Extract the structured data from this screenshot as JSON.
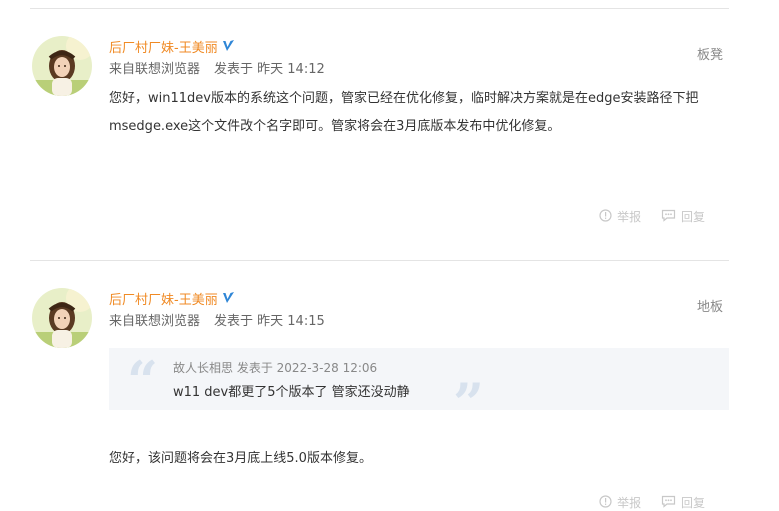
{
  "posts": [
    {
      "author": "后厂村厂妹-王美丽",
      "source": "来自联想浏览器",
      "posted": "发表于 昨天 14:12",
      "floor": "板凳",
      "content_lines": [
        "您好，win11dev版本的系统这个问题，管家已经在优化修复，临时解决方案就是在edge安装路径下把",
        "msedge.exe这个文件改个名字即可。管家将会在3月底版本发布中优化修复。"
      ],
      "report_label": "举报",
      "reply_label": "回复"
    },
    {
      "author": "后厂村厂妹-王美丽",
      "source": "来自联想浏览器",
      "posted": "发表于 昨天 14:15",
      "floor": "地板",
      "quote": {
        "author": "故人长相思",
        "posted": "发表于 2022-3-28 12:06",
        "text": "w11 dev都更了5个版本了 管家还没动静"
      },
      "content_lines": [
        "您好，该问题将会在3月底上线5.0版本修复。"
      ],
      "report_label": "举报",
      "reply_label": "回复"
    }
  ],
  "colors": {
    "author": "#f08a24",
    "badge": "#2f86d6",
    "quote_bg": "#f4f6f9"
  },
  "icons": {
    "verified": "verified-v-icon",
    "report": "report-icon",
    "reply": "reply-icon"
  }
}
